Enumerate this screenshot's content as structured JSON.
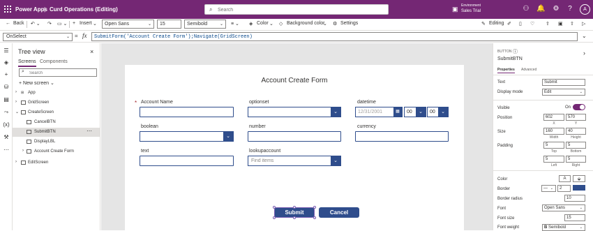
{
  "topbar": {
    "app_name": "Power Apps",
    "separator": "|",
    "app_title": "Curd Operations (Editing)",
    "search_placeholder": "Search",
    "env_label": "Environment",
    "env_value": "Sales Trial",
    "avatar": "A",
    "bg_color": "#742774"
  },
  "toolbar": {
    "back": "Back",
    "insert": "Insert",
    "font": "Open Sans",
    "font_size": "15",
    "font_weight": "Semibold",
    "color": "Color",
    "background_color": "Background color",
    "settings": "Settings",
    "editing": "Editing"
  },
  "formula_bar": {
    "property": "OnSelect",
    "eq": "=",
    "fx": "fx",
    "formula": "SubmitForm('Account Create Form');Navigate(GridScreen)"
  },
  "tree": {
    "title": "Tree view",
    "tabs": [
      "Screens",
      "Components"
    ],
    "search_placeholder": "Search",
    "new_screen": "New screen",
    "items": [
      {
        "label": "App"
      },
      {
        "label": "GridScreen"
      },
      {
        "label": "CreateScreen"
      },
      {
        "label": "CancelBTN"
      },
      {
        "label": "SubmitBTN"
      },
      {
        "label": "DisplayLBL"
      },
      {
        "label": "Account Create Form"
      },
      {
        "label": "EditScreen"
      }
    ]
  },
  "form": {
    "title": "Account Create Form",
    "required_mark": "*",
    "labels": {
      "account_name": "Account Name",
      "optionset": "optionset",
      "datetime": "datetime",
      "boolean": "boolean",
      "number": "number",
      "currency": "currency",
      "text": "text",
      "lookupaccount": "lookupaccount"
    },
    "date_value": "12/31/2001",
    "hour": "00",
    "minute": "00",
    "lookup_placeholder": "Find items",
    "submit": "Submit",
    "cancel": "Cancel",
    "accent_color": "#2f4d8c"
  },
  "props": {
    "type": "BUTTON",
    "name": "SubmitBTN",
    "tabs": [
      "Properties",
      "Advanced"
    ],
    "text_label": "Text",
    "text_value": "Submit",
    "display_mode_label": "Display mode",
    "display_mode_value": "Edit",
    "visible_label": "Visible",
    "visible_value": "On",
    "position_label": "Position",
    "pos_x": "602",
    "pos_y": "570",
    "x_label": "X",
    "y_label": "Y",
    "size_label": "Size",
    "width": "160",
    "height": "40",
    "width_label": "Width",
    "height_label": "Height",
    "padding_label": "Padding",
    "pad_top": "5",
    "pad_bottom": "5",
    "pad_left": "5",
    "pad_right": "5",
    "top_label": "Top",
    "bottom_label": "Bottom",
    "left_label": "Left",
    "right_label": "Right",
    "color_label": "Color",
    "border_label": "Border",
    "border_width": "2",
    "border_radius_label": "Border radius",
    "border_radius": "10",
    "font_label": "Font",
    "font_value": "Open Sans",
    "font_size_label": "Font size",
    "font_size": "15",
    "font_weight_label": "Font weight",
    "font_weight": "Semibold"
  }
}
